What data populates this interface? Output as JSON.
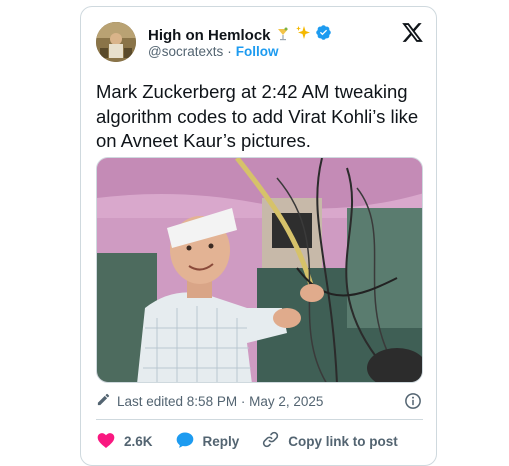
{
  "author": {
    "name": "High on Hemlock",
    "handle": "@socratexts",
    "separator": "·",
    "follow_label": "Follow"
  },
  "tweet": {
    "text": "Mark Zuckerberg at 2:42 AM tweaking algorithm codes to add Virat Kohli’s like on Avneet Kaur’s pictures."
  },
  "meta": {
    "edited_label": "Last edited 8:58 PM · May 2, 2025"
  },
  "actions": {
    "likes": "2.6K",
    "reply_label": "Reply",
    "copy_label": "Copy link to post"
  },
  "colors": {
    "accent": "#1d9bf0",
    "heart": "#f91880",
    "text": "#0f1419",
    "muted": "#536471"
  }
}
